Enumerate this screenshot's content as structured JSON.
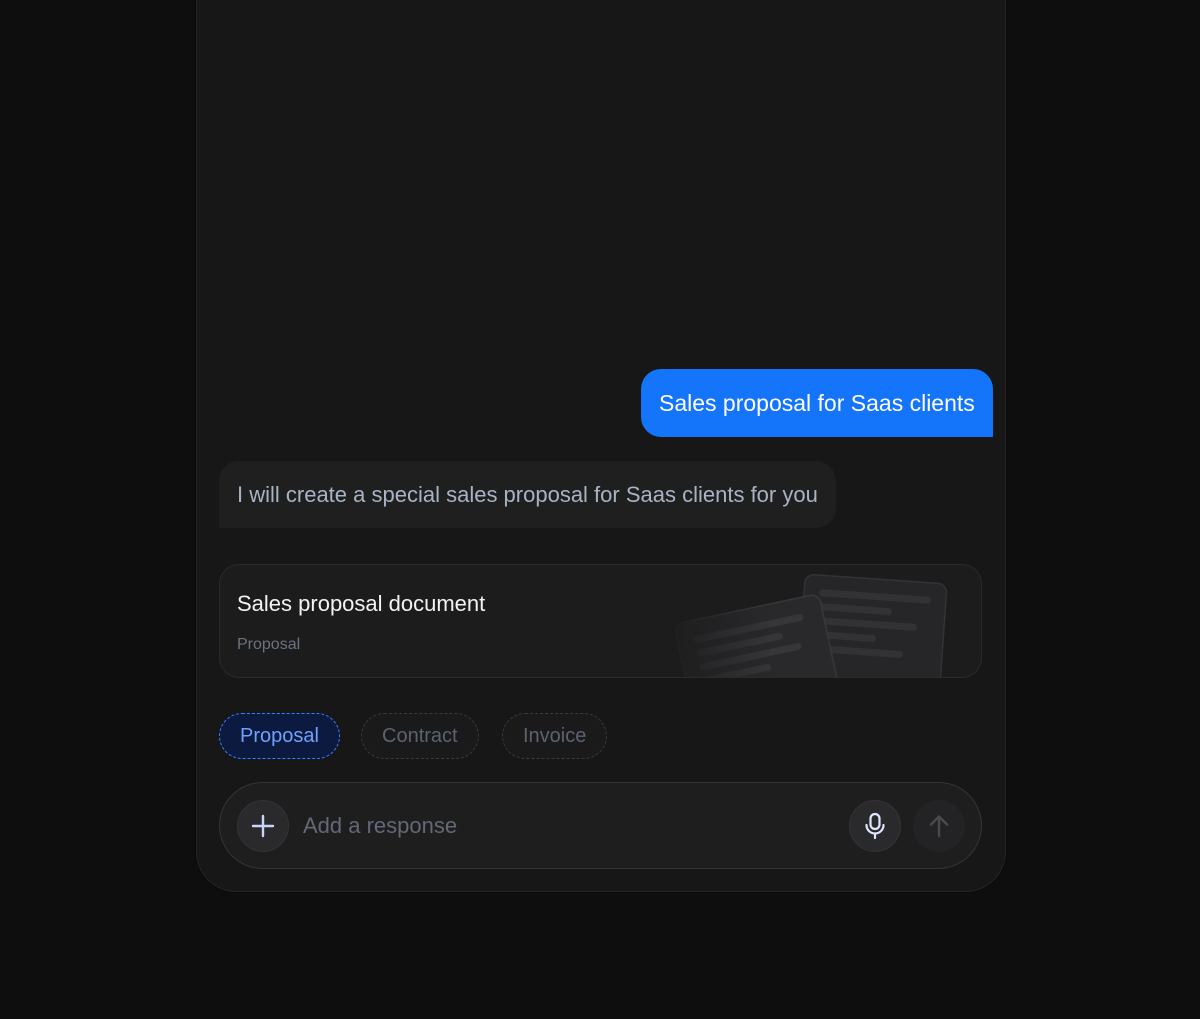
{
  "conversation": {
    "user_message": "Sales proposal for Saas clients",
    "assistant_message": "I will create a special sales proposal for Saas clients for you"
  },
  "document_card": {
    "title": "Sales proposal document",
    "subtitle": "Proposal",
    "icon": "document-stack-icon"
  },
  "chips": [
    {
      "label": "Proposal",
      "selected": true
    },
    {
      "label": "Contract",
      "selected": false
    },
    {
      "label": "Invoice",
      "selected": false
    }
  ],
  "composer": {
    "placeholder": "Add a response",
    "add_icon": "plus-icon",
    "mic_icon": "microphone-icon",
    "send_icon": "arrow-up-icon"
  },
  "colors": {
    "accent": "#1474fa",
    "background": "#0e0e0f",
    "panel": "#171718",
    "chip_active_border": "#3d7bff"
  }
}
